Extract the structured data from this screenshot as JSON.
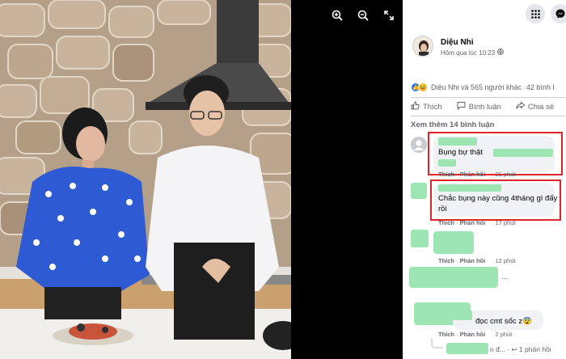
{
  "viewer": {
    "tools": [
      "zoom-in",
      "zoom-out",
      "fullscreen"
    ]
  },
  "post": {
    "author": "Diệu Nhi",
    "time": "Hôm qua lúc 10:23",
    "reactions_text": "Diệu Nhi và 565 người khác",
    "comments_count": "42 bình l",
    "actions": {
      "like": "Thích",
      "comment": "Bình luận",
      "share": "Chia sẻ"
    },
    "see_more": "Xem thêm 14 bình luận"
  },
  "comments": [
    {
      "text": "Bụng bự thật",
      "like": "Thích",
      "reply": "Phản hồi",
      "time": "21 phút"
    },
    {
      "text_line1": "Chắc bụng này cũng 4tháng gì đấy",
      "text_line2": "rồi",
      "like": "Thích",
      "reply": "Phản hồi",
      "time": "17 phút"
    },
    {
      "like": "Thích",
      "reply": "Phản hồi",
      "time": "12 phút"
    },
    {
      "more": "..."
    },
    {
      "text": "đọc cmt sốc z",
      "emoji": "😨",
      "like": "Thích",
      "reply": "Phản hồi",
      "time": "2 phút"
    },
    {
      "reply_prefix": "n đ...",
      "reply_count": "1 phản hồi"
    }
  ],
  "colors": {
    "highlight": "#e0242b",
    "blur": "#9de6b3"
  }
}
